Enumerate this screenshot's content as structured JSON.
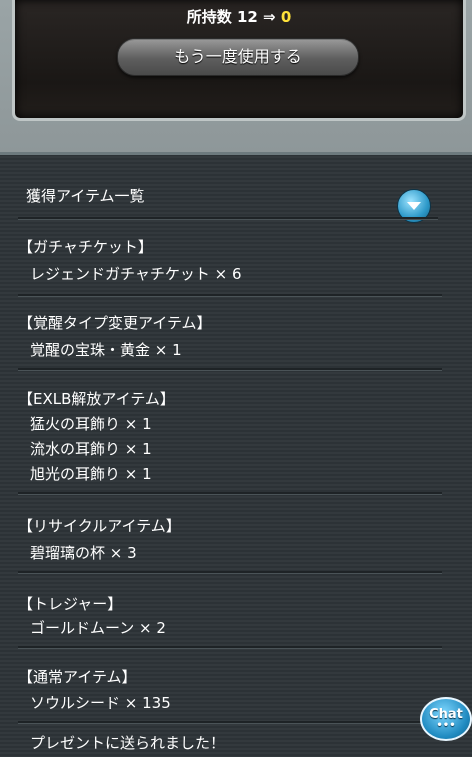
{
  "dialog": {
    "stock_prefix": "所持数 12 ⇒",
    "stock_after": "0",
    "reuse_button_label": "もう一度使用する"
  },
  "list": {
    "header_title": "獲得アイテム一覧",
    "groups": [
      {
        "title": "【ガチャチケット】",
        "items": [
          "レジェンドガチャチケット × 6"
        ]
      },
      {
        "title": "【覚醒タイプ変更アイテム】",
        "items": [
          "覚醒の宝珠・黄金 × 1"
        ]
      },
      {
        "title": "【EXLB解放アイテム】",
        "items": [
          "猛火の耳飾り × 1",
          "流水の耳飾り × 1",
          "旭光の耳飾り × 1"
        ]
      },
      {
        "title": "【リサイクルアイテム】",
        "items": [
          "碧瑠璃の杯 × 3"
        ]
      },
      {
        "title": "【トレジャー】",
        "items": [
          "ゴールドムーン × 2"
        ]
      },
      {
        "title": "【通常アイテム】",
        "items": [
          "ソウルシード × 135"
        ]
      }
    ],
    "footer_message": "プレゼントに送られました！"
  },
  "chat": {
    "label": "Chat",
    "dots": "•••"
  },
  "colors": {
    "highlight": "#ffe23a",
    "accent": "#2c98c8"
  },
  "icons": {
    "toggle": "chevron-down-icon"
  }
}
